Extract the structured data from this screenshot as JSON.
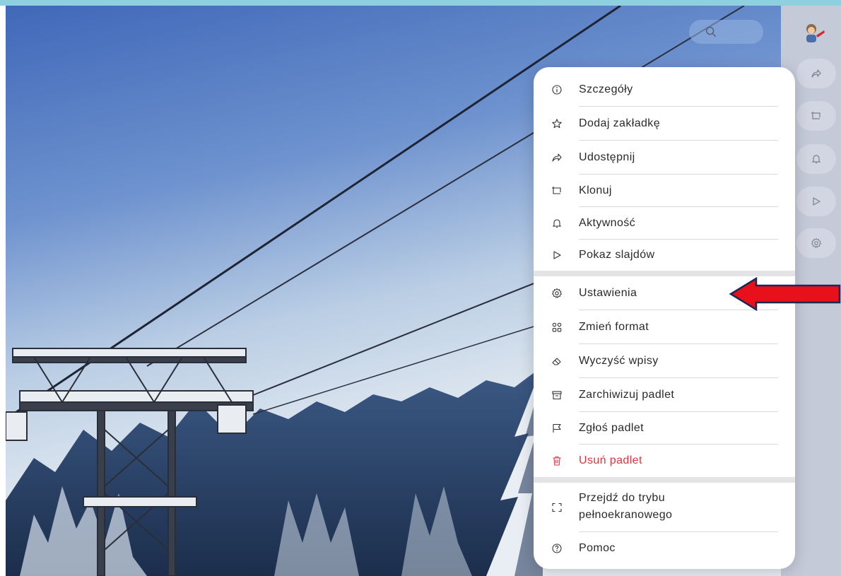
{
  "menu": {
    "items": [
      {
        "label": "Szczegóły",
        "icon": "info-icon"
      },
      {
        "label": "Dodaj zakładkę",
        "icon": "star-icon"
      },
      {
        "label": "Udostępnij",
        "icon": "share-icon"
      },
      {
        "label": "Klonuj",
        "icon": "clone-icon"
      },
      {
        "label": "Aktywność",
        "icon": "bell-icon"
      },
      {
        "label": "Pokaz slajdów",
        "icon": "play-icon"
      },
      {
        "label": "Ustawienia",
        "icon": "gear-icon"
      },
      {
        "label": "Zmień format",
        "icon": "grid-icon"
      },
      {
        "label": "Wyczyść wpisy",
        "icon": "eraser-icon"
      },
      {
        "label": "Zarchiwizuj padlet",
        "icon": "archive-icon"
      },
      {
        "label": "Zgłoś padlet",
        "icon": "flag-icon"
      },
      {
        "label": "Usuń padlet",
        "icon": "trash-icon",
        "color": "#e0353d"
      },
      {
        "label": "Przejdź do trybu",
        "label2": "pełnoekranowego",
        "icon": "fullscreen-icon"
      },
      {
        "label": "Pomoc",
        "icon": "help-icon"
      }
    ]
  },
  "rail": {
    "buttons": [
      "share-icon",
      "clone-icon",
      "bell-icon",
      "play-icon",
      "gear-icon"
    ]
  },
  "colors": {
    "accent_arrow": "#e8101a",
    "danger": "#e0353d",
    "rail": "#c5cad9"
  }
}
